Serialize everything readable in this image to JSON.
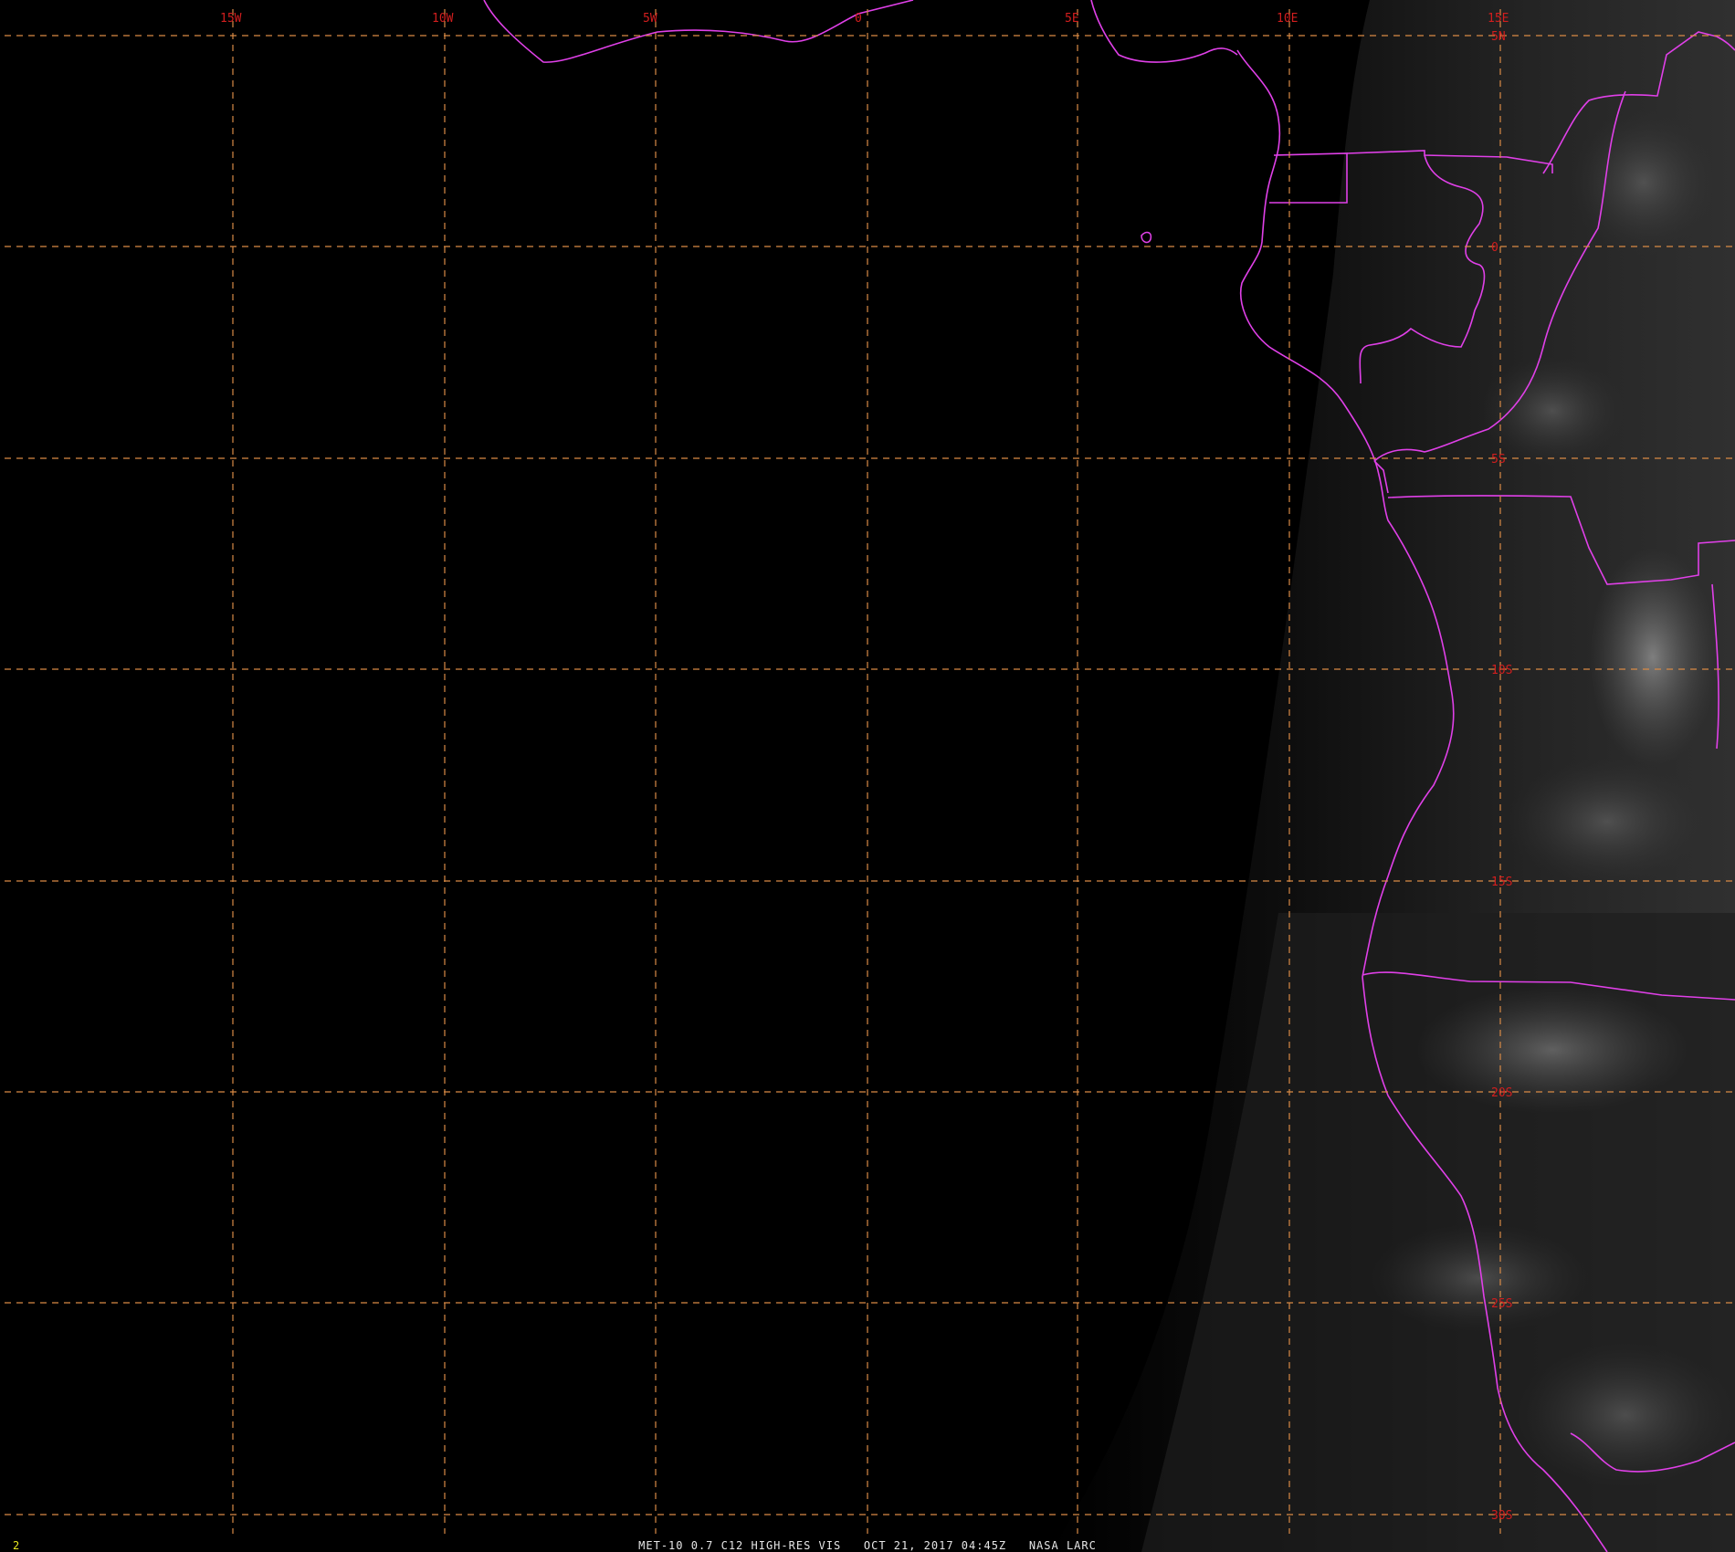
{
  "image": {
    "frame_number": "2",
    "caption": "MET-10 0.7 C12 HIGH-RES VIS   OCT 21, 2017 04:45Z   NASA LARC"
  },
  "map": {
    "colors": {
      "background": "#000000",
      "gridline": "#d98a45",
      "grid_label": "#d21e1e",
      "border": "#e040e8",
      "caption_text": "#e6e6e6",
      "frame_number_text": "#e8e820"
    },
    "longitude_labels": [
      "15W",
      "10W",
      "5W",
      "0",
      "5E",
      "10E",
      "15E"
    ],
    "latitude_labels": [
      "5N",
      "0",
      "5S",
      "10S",
      "15S",
      "20S",
      "25S",
      "30S"
    ]
  }
}
